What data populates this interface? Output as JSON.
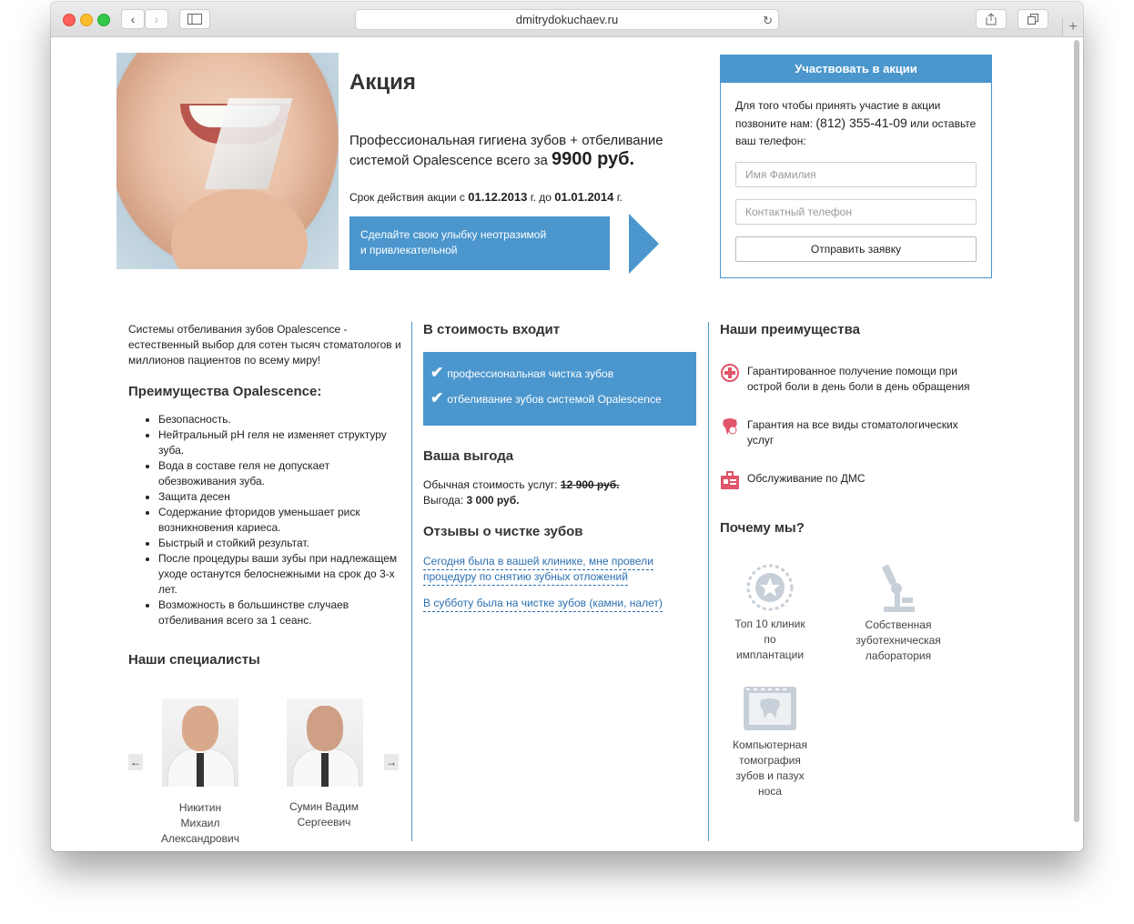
{
  "browser": {
    "url": "dmitrydokuchaev.ru",
    "back_glyph": "‹",
    "forward_glyph": "›",
    "reload_glyph": "↻",
    "new_tab_glyph": "+"
  },
  "promo": {
    "title": "Акция",
    "desc_prefix": "Профессиональная гигиена зубов + отбеливание системой Opalescence всего за",
    "price": "9900 руб.",
    "dates_prefix": "Срок действия акции с",
    "date_from": "01.12.2013",
    "dates_mid": "г. до",
    "date_to": "01.01.2014",
    "dates_suffix": "г.",
    "cta_line1": "Сделайте свою улыбку неотразимой",
    "cta_line2": "и привлекательной"
  },
  "form": {
    "title": "Участвовать в акции",
    "text_before": "Для того чтобы принять участие в акции позвоните нам:",
    "phone": "(812) 355-41-09",
    "text_after": "или оставьте ваш телефон:",
    "name_placeholder": "Имя Фамилия",
    "phone_placeholder": "Контактный телефон",
    "submit_label": "Отправить заявку"
  },
  "col1": {
    "intro": "Системы отбеливания зубов Opalescence - естественный выбор для сотен тысяч стоматологов и миллионов пациентов по всему миру!",
    "benefits_title": "Преимущества Opalescence:",
    "benefits": [
      "Безопасность.",
      "Нейтральный pH геля не изменяет структуру зуба.",
      "Вода в составе геля не допускает обезвоживания зуба.",
      "Защита десен",
      "Содержание фторидов уменьшает риск возникновения кариеса.",
      "Быстрый и стойкий результат.",
      "После процедуры ваши зубы при надлежащем уходе останутся белоснежными на срок до 3-х лет.",
      "Возможность в большинстве случаев отбеливания всего за 1 сеанс."
    ],
    "specialists_title": "Наши специалисты",
    "prev_arrow": "←",
    "next_arrow": "→",
    "specialists": [
      {
        "line1": "Никитин",
        "line2": "Михаил",
        "line3": "Александрович"
      },
      {
        "line1": "Сумин Вадим",
        "line2": "Сергеевич"
      }
    ]
  },
  "col2": {
    "includes_title": "В стоимость входит",
    "check_glyph": "✔",
    "includes": [
      "профессиональная чистка зубов",
      "отбеливание зубов системой Opalescence"
    ],
    "gain_title": "Ваша выгода",
    "regular_label": "Обычная стоимость услуг:",
    "regular_price": "12 900 руб.",
    "gain_label": "Выгода:",
    "gain_value": "3 000 руб.",
    "reviews_title": "Отзывы о чистке зубов",
    "review1_line1": "Сегодня была в вашей клинике, мне провели",
    "review1_line2": "процедуру по снятию зубных отложений",
    "review2": "В субботу была на чистке зубов (камни, налет)"
  },
  "col3": {
    "advantages_title": "Наши преимущества",
    "advantages": [
      {
        "icon": "medical-cross-icon",
        "line1": "Гарантированное получение помощи при",
        "line2": "острой боли в день боли в день обращения"
      },
      {
        "icon": "tooth-guarantee-icon",
        "line1": "Гарантия на все виды стоматологических",
        "line2": "услуг"
      },
      {
        "icon": "medical-card-icon",
        "line1": "Обслуживание по ДМС",
        "line2": ""
      }
    ],
    "why_title": "Почему мы?",
    "why": [
      {
        "icon": "award-star-icon",
        "line1": "Топ 10 клиник",
        "line2": "по",
        "line3": "имплантации",
        "line4": ""
      },
      {
        "icon": "microscope-icon",
        "line1": "Собственная",
        "line2": "зуботехническая",
        "line3": "лаборатория",
        "line4": ""
      },
      {
        "icon": "tomography-icon",
        "line1": "Компьютерная",
        "line2": "томография",
        "line3": "зубов и пазух",
        "line4": "носа"
      }
    ]
  },
  "colors": {
    "accent": "#4a96cd",
    "icon_red": "#e0556a",
    "icon_gray": "#c7cfd8"
  }
}
